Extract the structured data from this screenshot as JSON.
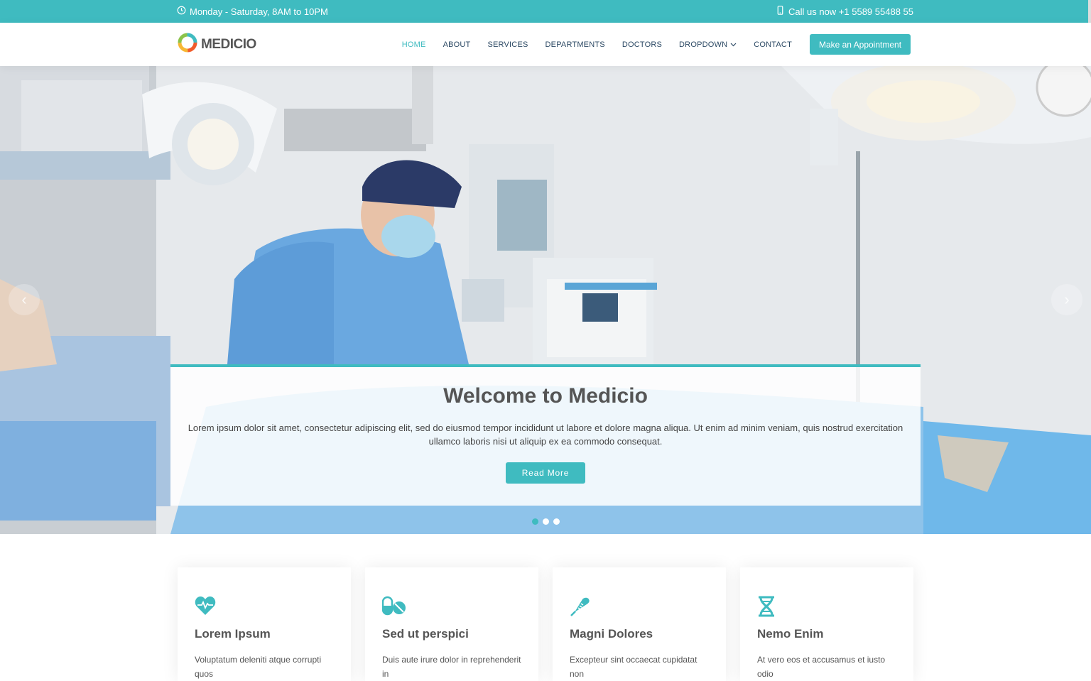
{
  "topbar": {
    "hours": "Monday - Saturday, 8AM to 10PM",
    "phone": "Call us now +1 5589 55488 55"
  },
  "header": {
    "logo": "MEDICIO",
    "nav": [
      {
        "label": "HOME",
        "active": true
      },
      {
        "label": "ABOUT"
      },
      {
        "label": "SERVICES"
      },
      {
        "label": "DEPARTMENTS"
      },
      {
        "label": "DOCTORS"
      },
      {
        "label": "DROPDOWN"
      },
      {
        "label": "CONTACT"
      }
    ],
    "appointment": "Make an Appointment"
  },
  "hero": {
    "title": "Welcome to Medicio",
    "text": "Lorem ipsum dolor sit amet, consectetur adipiscing elit, sed do eiusmod tempor incididunt ut labore et dolore magna aliqua. Ut enim ad minim veniam, quis nostrud exercitation ullamco laboris nisi ut aliquip ex ea commodo consequat.",
    "button": "Read More",
    "slides": 3,
    "active_slide": 1
  },
  "features": [
    {
      "icon": "heart-pulse-icon",
      "title": "Lorem Ipsum",
      "text": "Voluptatum deleniti atque corrupti quos"
    },
    {
      "icon": "capsule-pill-icon",
      "title": "Sed ut perspici",
      "text": "Duis aute irure dolor in reprehenderit in"
    },
    {
      "icon": "syringe-icon",
      "title": "Magni Dolores",
      "text": "Excepteur sint occaecat cupidatat non"
    },
    {
      "icon": "dna-icon",
      "title": "Nemo Enim",
      "text": "At vero eos et accusamus et iusto odio"
    }
  ],
  "colors": {
    "accent": "#3fbbc0",
    "heading": "#555555",
    "nav": "#2c4964"
  }
}
